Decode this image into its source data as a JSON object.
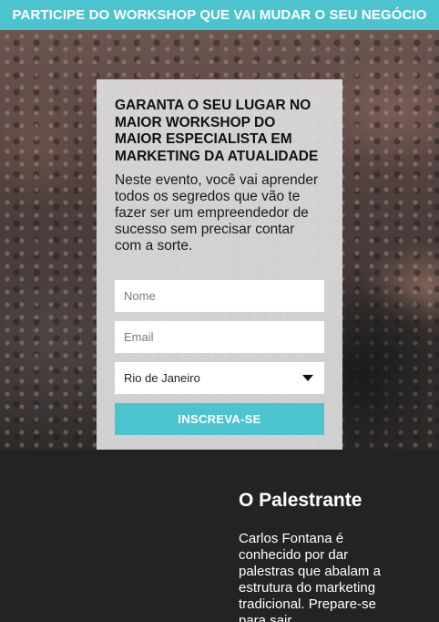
{
  "banner": {
    "text": "PARTICIPE DO WORKSHOP QUE VAI MUDAR O SEU NEGÓCIO"
  },
  "form": {
    "title": "GARANTA O SEU LUGAR NO MAIOR WORKSHOP DO MAIOR ESPECIALISTA EM MARKETING DA ATUALIDADE",
    "description": "Neste evento, você vai aprender todos os segredos que vão te fazer ser um empreendedor de sucesso sem precisar contar com a sorte.",
    "name_placeholder": "Nome",
    "email_placeholder": "Email",
    "city_selected": "Rio de Janeiro",
    "submit_label": "INSCREVA-SE"
  },
  "speaker": {
    "heading": "O Palestrante",
    "bio": "Carlos Fontana é conhecido por dar palestras que abalam a estrutura do marketing tradicional. Prepare-se para sair"
  },
  "colors": {
    "accent": "#4cc4d0",
    "dark_bg": "#232323",
    "card_bg": "#dedede"
  }
}
